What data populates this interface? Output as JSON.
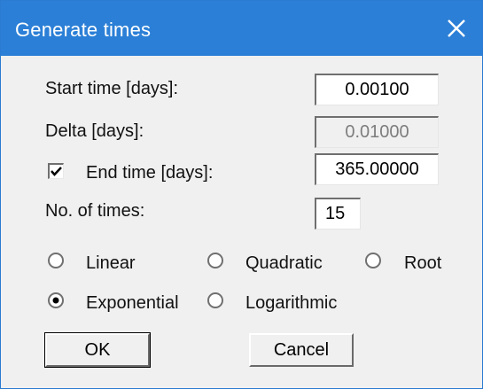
{
  "window": {
    "title": "Generate times",
    "close_icon": "close-icon"
  },
  "fields": {
    "start_time_label": "Start time [days]:",
    "start_time_value": "0.00100",
    "delta_label": "Delta [days]:",
    "delta_value": "0.01000",
    "end_time_label": "End time [days]:",
    "end_time_value": "365.00000",
    "end_time_checked": true,
    "count_label": "No. of times:",
    "count_value": "15"
  },
  "distribution": {
    "options": [
      {
        "label": "Linear",
        "selected": false
      },
      {
        "label": "Quadratic",
        "selected": false
      },
      {
        "label": "Root",
        "selected": false
      },
      {
        "label": "Exponential",
        "selected": true
      },
      {
        "label": "Logarithmic",
        "selected": false
      }
    ]
  },
  "buttons": {
    "ok": "OK",
    "cancel": "Cancel"
  },
  "colors": {
    "titlebar": "#2b7fd6",
    "dialog_bg": "#f0f0f0"
  }
}
